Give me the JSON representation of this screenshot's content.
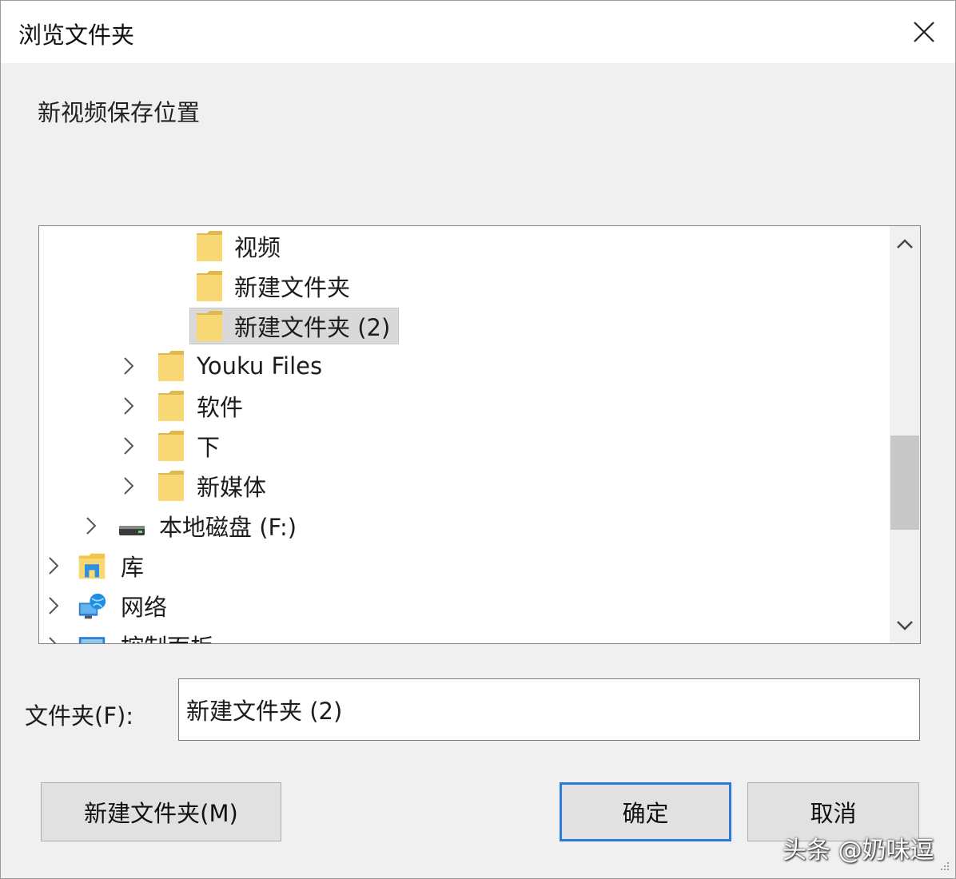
{
  "window": {
    "title": "浏览文件夹",
    "close_icon": "close-icon"
  },
  "description": "新视频保存位置",
  "tree": {
    "items": [
      {
        "label": "视频",
        "icon": "folder-icon",
        "expander": false
      },
      {
        "label": "新建文件夹",
        "icon": "folder-icon",
        "expander": false
      },
      {
        "label": "新建文件夹 (2)",
        "icon": "folder-icon",
        "expander": false,
        "selected": true
      },
      {
        "label": "Youku Files",
        "icon": "folder-icon",
        "expander": true
      },
      {
        "label": "软件",
        "icon": "folder-icon",
        "expander": true
      },
      {
        "label": "下",
        "icon": "folder-icon",
        "expander": true
      },
      {
        "label": "新媒体",
        "icon": "folder-icon",
        "expander": true
      },
      {
        "label": "本地磁盘 (F:)",
        "icon": "drive-icon",
        "expander": true
      },
      {
        "label": "库",
        "icon": "library-icon",
        "expander": true
      },
      {
        "label": "网络",
        "icon": "network-icon",
        "expander": true
      },
      {
        "label": "控制面板",
        "icon": "control-panel-icon",
        "expander": true
      }
    ]
  },
  "folder_field": {
    "label": "文件夹(F):",
    "value": "新建文件夹 (2)"
  },
  "buttons": {
    "new_folder": "新建文件夹(M)",
    "ok": "确定",
    "cancel": "取消"
  },
  "watermark": "头条 @奶味逗",
  "colors": {
    "folder": "#f8d775",
    "folder_dark": "#e0b94e",
    "accent": "#2a7ad6",
    "selection": "#d9d9d9"
  }
}
